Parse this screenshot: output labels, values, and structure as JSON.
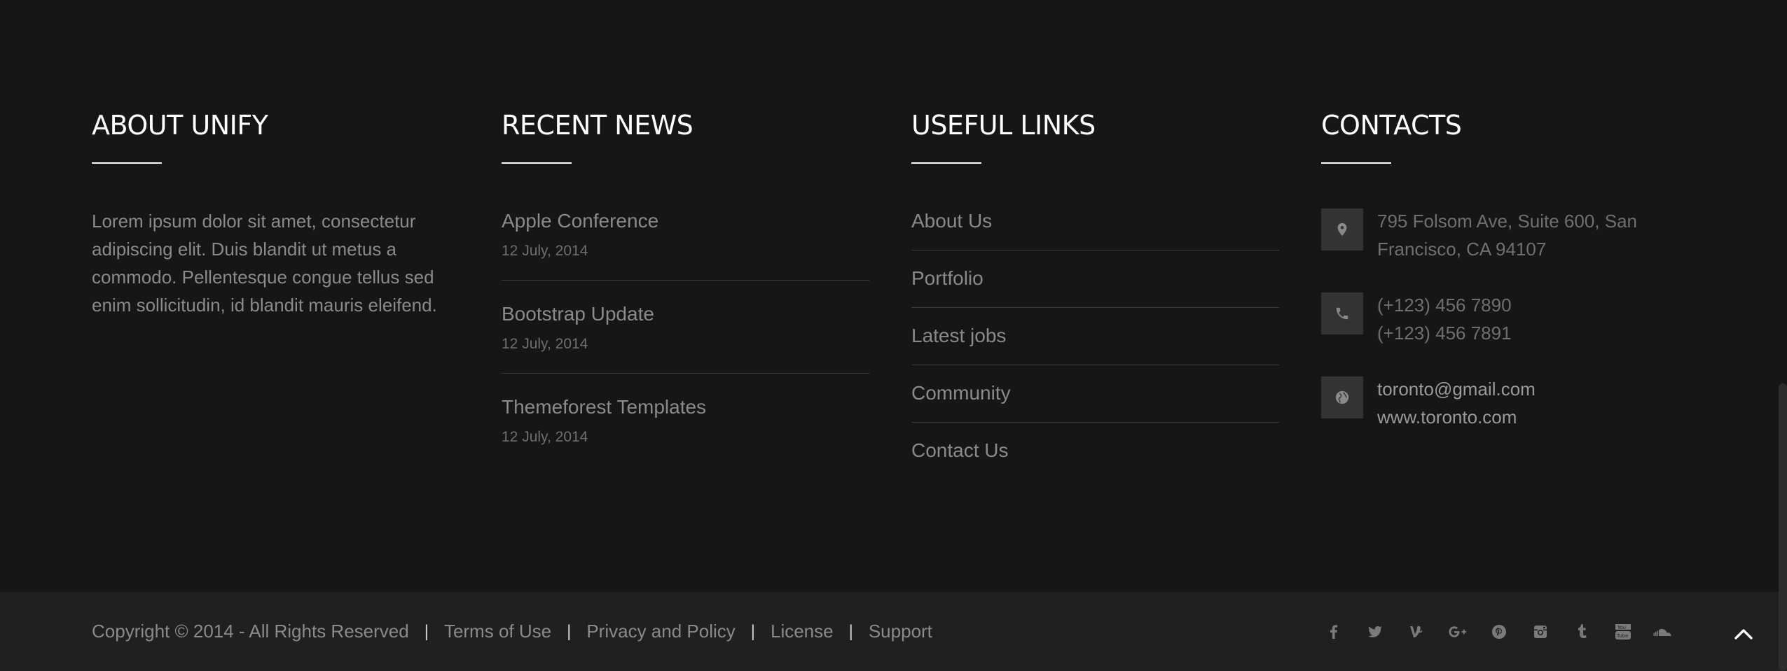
{
  "about": {
    "heading": "ABOUT UNIFY",
    "text": "Lorem ipsum dolor sit amet, consectetur adipiscing elit. Duis blandit ut metus a commodo. Pellentesque congue tellus sed enim sollicitudin, id blandit mauris eleifend."
  },
  "news": {
    "heading": "RECENT NEWS",
    "items": [
      {
        "title": "Apple Conference",
        "date": "12 July, 2014"
      },
      {
        "title": "Bootstrap Update",
        "date": "12 July, 2014"
      },
      {
        "title": "Themeforest Templates",
        "date": "12 July, 2014"
      }
    ]
  },
  "links": {
    "heading": "USEFUL LINKS",
    "items": [
      "About Us",
      "Portfolio",
      "Latest jobs",
      "Community",
      "Contact Us"
    ]
  },
  "contacts": {
    "heading": "CONTACTS",
    "address_line1": "795 Folsom Ave, Suite 600, San",
    "address_line2": "Francisco, CA 94107",
    "phone1": "(+123) 456 7890",
    "phone2": "(+123) 456 7891",
    "email": "toronto@gmail.com",
    "website": "www.toronto.com",
    "icons": [
      "map-marker-icon",
      "phone-icon",
      "globe-icon"
    ]
  },
  "bottom": {
    "copyright": "Copyright © 2014 - All Rights Reserved",
    "separator": "|",
    "links": [
      "Terms of Use",
      "Privacy and Policy",
      "License",
      "Support"
    ]
  },
  "social_icons": [
    "facebook-icon",
    "twitter-icon",
    "vine-icon",
    "google-plus-icon",
    "pinterest-icon",
    "instagram-icon",
    "tumblr-icon",
    "youtube-icon",
    "soundcloud-icon"
  ],
  "colors": {
    "background": "#161616",
    "bottom_bar": "#202020",
    "heading": "#ffffff",
    "text": "#8a8a8a",
    "icon_box": "#333333"
  }
}
